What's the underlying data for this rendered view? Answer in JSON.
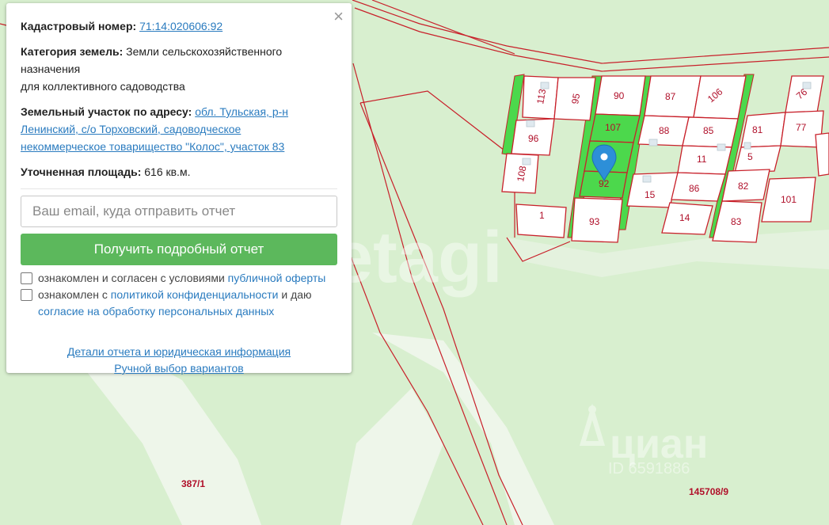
{
  "panel": {
    "cadastral_label": "Кадастровый номер:",
    "cadastral_value": "71:14:020606:92",
    "category_label": "Категория земель:",
    "category_value_1": "Земли сельскохозяйственного",
    "category_value_2": "назначения",
    "category_value_3": "для коллективного садоводства",
    "address_label": "Земельный участок по адресу:",
    "address_value_1": "обл. Тульская, р-н",
    "address_value_2": "Ленинский, с/о Торховский, садоводческое",
    "address_value_3": "некоммерческое товарищество \"Колос\", участок 83",
    "area_label": "Уточненная площадь:",
    "area_value": "616 кв.м.",
    "email_placeholder": "Ваш email, куда отправить отчет",
    "submit_label": "Получить подробный отчет",
    "consent1_text": "ознакомлен и согласен с условиями",
    "consent1_link": "публичной оферты",
    "consent2_text": "ознакомлен с",
    "consent2_link": "политикой конфиденциальности",
    "consent2_text2": "и даю",
    "consent2_link2": "согласие на обработку персональных данных",
    "details_link": "Детали отчета и юридическая информация",
    "manual_link": "Ручной выбор вариантов",
    "close_icon": "×"
  },
  "map": {
    "plots": [
      "113",
      "95",
      "90",
      "87",
      "106",
      "76",
      "107",
      "88",
      "85",
      "81",
      "77",
      "96",
      "11",
      "5",
      "108",
      "92",
      "15",
      "86",
      "82",
      "101",
      "1",
      "93",
      "14",
      "83"
    ],
    "cadastral_labels": [
      "387/1",
      "145708/9"
    ],
    "marker_icon": "map-pin-icon"
  },
  "watermarks": {
    "etagi": "etagi",
    "cian": "циан",
    "cian_id": "ID 6591886"
  },
  "colors": {
    "map_bg": "#d8efcf",
    "plot_border": "#c8202a",
    "plot_fill": "#ffffff",
    "selected_plot": "#4cd84c",
    "button": "#5cb85c",
    "link": "#2a7bbf"
  }
}
